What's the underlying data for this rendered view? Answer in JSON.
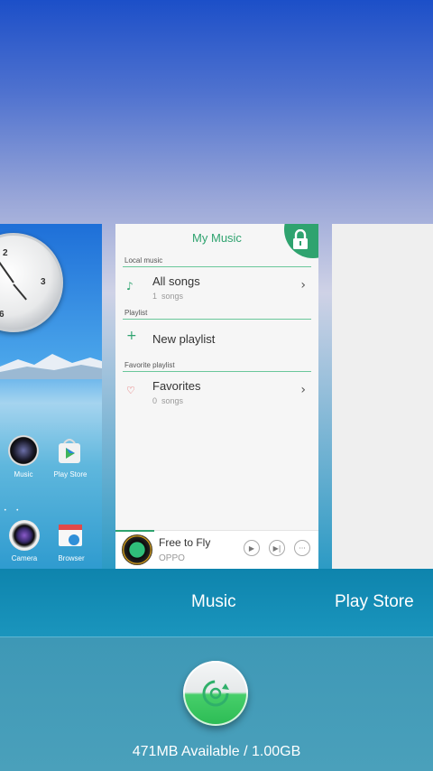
{
  "home_card": {
    "clock_numbers": [
      "2",
      "3",
      "6"
    ],
    "apps": [
      {
        "label": "Music",
        "icon": "music-app-icon"
      },
      {
        "label": "Play Store",
        "icon": "play-store-icon"
      },
      {
        "label": "Camera",
        "icon": "camera-icon"
      },
      {
        "label": "Browser",
        "icon": "browser-icon"
      }
    ],
    "page_dots": "• •"
  },
  "music_card": {
    "title": "My Music",
    "sections": [
      {
        "label": "Local music",
        "item": {
          "title": "All songs",
          "count": "1",
          "unit": "songs",
          "icon": "music-note-icon",
          "has_chevron": true
        }
      },
      {
        "label": "Playlist",
        "item": {
          "title": "New playlist",
          "icon": "plus-icon",
          "has_chevron": false
        }
      },
      {
        "label": "Favorite playlist",
        "item": {
          "title": "Favorites",
          "count": "0",
          "unit": "songs",
          "icon": "heart-icon",
          "has_chevron": true
        }
      }
    ],
    "player": {
      "song": "Free to Fly",
      "artist": "OPPO",
      "progress": 0.19
    }
  },
  "labels": {
    "music": "Music",
    "play_store": "Play Store"
  },
  "memory": {
    "text": "471MB Available / 1.00GB"
  },
  "colors": {
    "accent_green": "#2fa36f",
    "band_blue": "#0e84ad"
  }
}
